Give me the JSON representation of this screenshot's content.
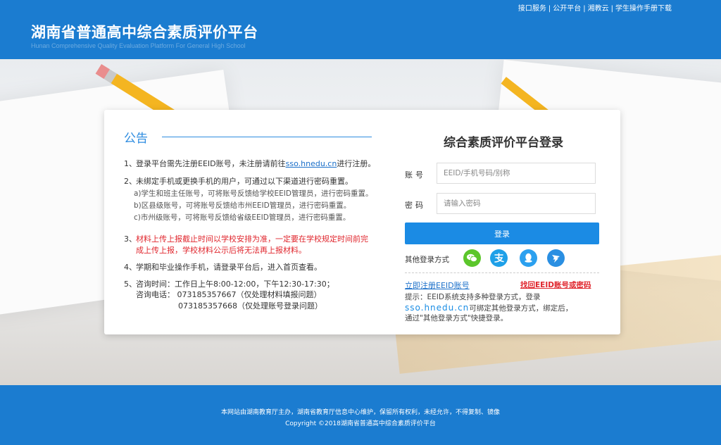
{
  "header": {
    "top_links": [
      "接口服务",
      "公开平台",
      "湘教云",
      "学生操作手册下载"
    ],
    "title": "湖南省普通高中综合素质评价平台",
    "subtitle": "Hunan Comprehensive Quality Evaluation Platform For General High School"
  },
  "notice": {
    "heading": "公告",
    "item1": {
      "num": "1、",
      "text_before": "登录平台需先注册EEID账号，未注册请前往",
      "link": "sso.hnedu.cn",
      "text_after": "进行注册。"
    },
    "item2": {
      "num": "2、",
      "text": "未绑定手机或更换手机的用户，可通过以下渠道进行密码重置。",
      "subs": [
        "a)学生和班主任账号，可将账号反馈给学校EEID管理员，进行密码重置。",
        "b)区县级账号，可将账号反馈给市州EEID管理员，进行密码重置。",
        "c)市州级账号，可将账号反馈给省级EEID管理员，进行密码重置。"
      ]
    },
    "item3": {
      "num": "3、",
      "line1": "材料上传上报截止时间以学校安排为准，一定要在学校规定时间前完",
      "line2": "成上传上报，学校材料公示后将无法再上报材料。"
    },
    "item4": {
      "num": "4、",
      "text": "学期和毕业操作手机，请登录平台后，进入首页查看。"
    },
    "item5": {
      "num": "5、",
      "line1": "咨询时间：工作日上午8:00-12:00，下午12:30-17:30；",
      "line2": "咨询电话：  073185357667（仅处理材料填报问题）",
      "line3": "073185357668（仅处理账号登录问题）"
    }
  },
  "login": {
    "title": "综合素质评价平台登录",
    "account_label": "账号",
    "account_placeholder": "EEID/手机号码/别称",
    "password_label": "密码",
    "password_placeholder": "请输入密码",
    "submit_label": "登录",
    "other_label": "其他登录方式",
    "social": [
      {
        "name": "wechat-icon",
        "color": "#5cc62b"
      },
      {
        "name": "alipay-icon",
        "color": "#1ea0e8"
      },
      {
        "name": "qq-icon",
        "color": "#2ba0ef"
      },
      {
        "name": "dingtalk-icon",
        "color": "#2a8fe2"
      }
    ],
    "register_link": "立即注册EEID账号",
    "recover_link": "找回EEID账号或密码",
    "tip_line1": "提示：EEID系统支持多种登录方式，登录",
    "tip_domain": "sso.hnedu.cn",
    "tip_line2_rest": "可绑定其他登录方式，绑定后，",
    "tip_line3": "通过\"其他登录方式\"快捷登录。"
  },
  "footer": {
    "line1": "本网站由湖南教育厅主办，湖南省教育厅信息中心维护，保留所有权利，未经允许，不得复制、镜像",
    "line2": "Copyright ©2018湖南省普通高中综合素质评价平台"
  }
}
